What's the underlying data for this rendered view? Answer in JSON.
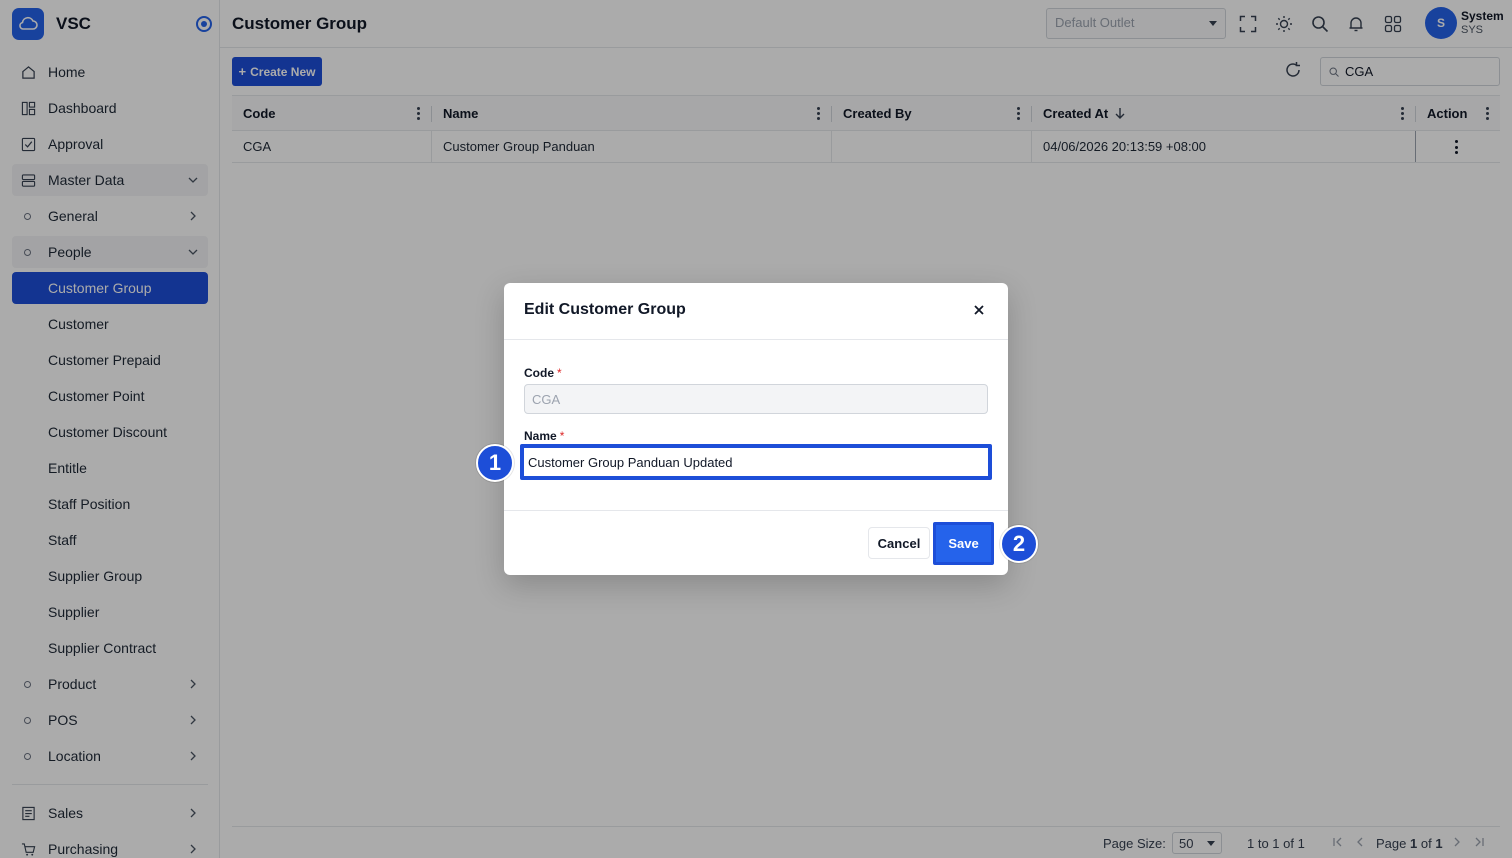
{
  "brand": {
    "name": "VSC"
  },
  "sidebar": {
    "items": [
      {
        "label": "Home",
        "icon": "home-icon"
      },
      {
        "label": "Dashboard",
        "icon": "dashboard-icon"
      },
      {
        "label": "Approval",
        "icon": "approval-icon"
      },
      {
        "label": "Master Data",
        "icon": "master-data-icon",
        "expanded": true
      },
      {
        "label": "General"
      },
      {
        "label": "People",
        "expanded": true
      },
      {
        "label": "Customer Group",
        "active": true
      },
      {
        "label": "Customer"
      },
      {
        "label": "Customer Prepaid"
      },
      {
        "label": "Customer Point"
      },
      {
        "label": "Customer Discount"
      },
      {
        "label": "Entitle"
      },
      {
        "label": "Staff Position"
      },
      {
        "label": "Staff"
      },
      {
        "label": "Supplier Group"
      },
      {
        "label": "Supplier"
      },
      {
        "label": "Supplier Contract"
      },
      {
        "label": "Product"
      },
      {
        "label": "POS"
      },
      {
        "label": "Location"
      },
      {
        "label": "Sales",
        "icon": "sales-icon"
      },
      {
        "label": "Purchasing",
        "icon": "cart-icon"
      }
    ]
  },
  "header": {
    "title": "Customer Group",
    "outlet_placeholder": "Default Outlet",
    "user": {
      "initial": "S",
      "name": "System",
      "code": "SYS"
    }
  },
  "toolbar": {
    "create_label": "Create New",
    "search_value": "CGA"
  },
  "grid": {
    "columns": [
      "Code",
      "Name",
      "Created By",
      "Created At",
      "Action"
    ],
    "sort": {
      "column": "Created At",
      "direction": "desc"
    },
    "rows": [
      {
        "code": "CGA",
        "name": "Customer Group Panduan",
        "created_by": "",
        "created_at": "04/06/2026 20:13:59 +08:00"
      }
    ]
  },
  "footer": {
    "page_size_label": "Page Size:",
    "page_size": "50",
    "range": "1 to 1 of 1",
    "page_prefix": "Page",
    "page_current": "1",
    "page_of": "of",
    "page_total": "1"
  },
  "modal": {
    "title": "Edit Customer Group",
    "code_label": "Code",
    "code_value": "CGA",
    "name_label": "Name",
    "name_value": "Customer Group Panduan Updated",
    "required_mark": "*",
    "cancel_label": "Cancel",
    "save_label": "Save"
  },
  "annotations": {
    "step1": "1",
    "step2": "2"
  },
  "colors": {
    "accent": "#1d4ed8",
    "required": "#dc2626"
  }
}
